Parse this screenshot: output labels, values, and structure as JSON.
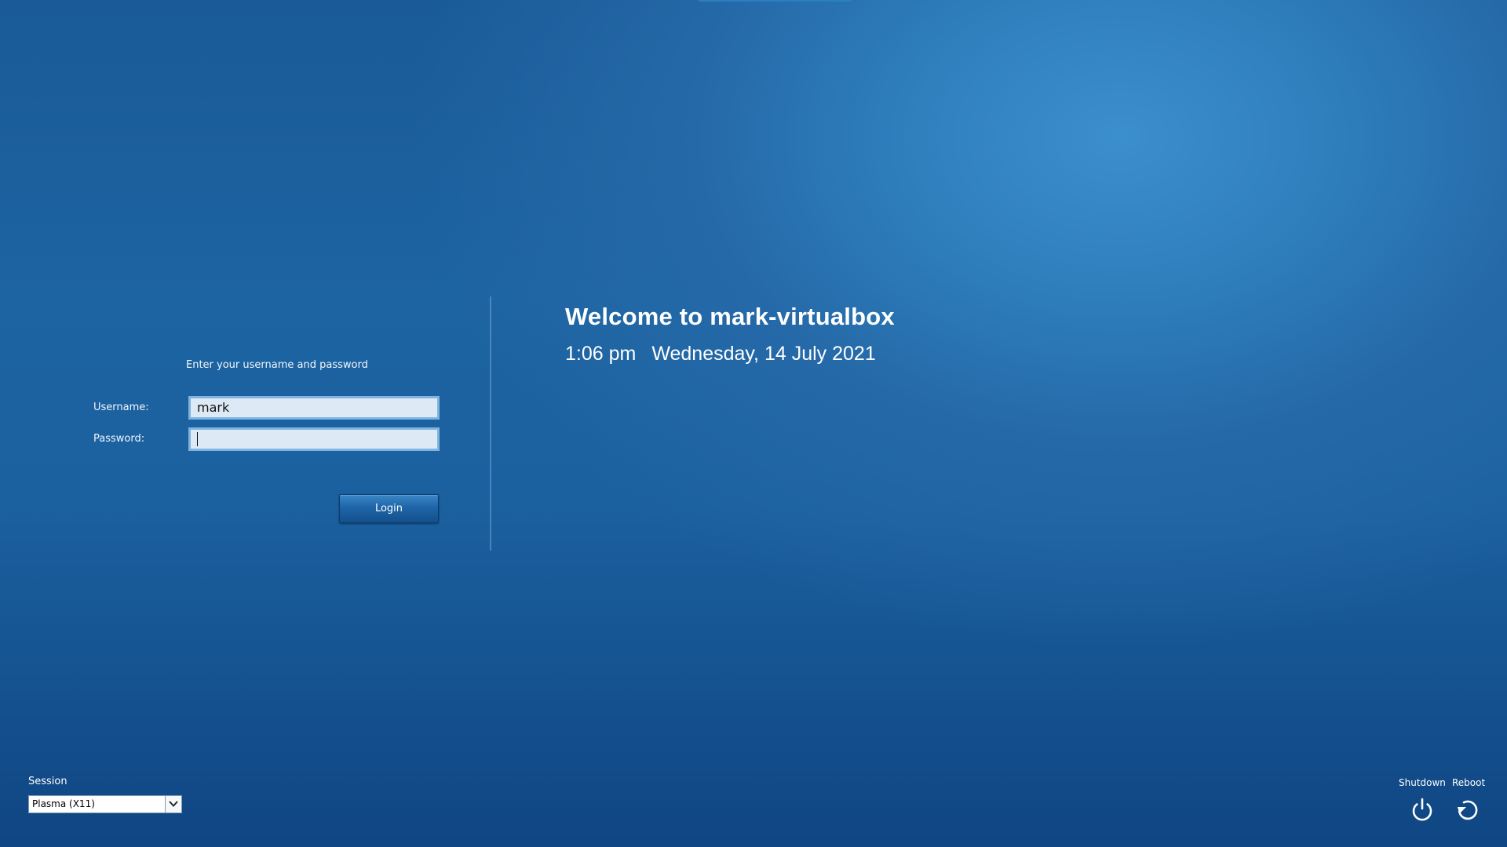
{
  "login": {
    "prompt": "Enter your username and password",
    "username_label": "Username:",
    "password_label": "Password:",
    "username_value": "mark",
    "password_value": "",
    "login_button": "Login"
  },
  "welcome": {
    "title": "Welcome to mark-virtualbox",
    "time": "1:06 pm",
    "date": "Wednesday, 14 July 2021"
  },
  "session": {
    "label": "Session",
    "selected": "Plasma (X11)",
    "dropdown_icon": "chevron-down-icon"
  },
  "power": {
    "shutdown_label": "Shutdown",
    "reboot_label": "Reboot",
    "shutdown_icon": "power-icon",
    "reboot_icon": "reboot-icon"
  },
  "colors": {
    "background_light": "#3b8fcc",
    "background_dark": "#0f4683",
    "field_background": "#dde9f4",
    "field_border": "#7fb4e0",
    "button_background": "#1f66a8"
  }
}
